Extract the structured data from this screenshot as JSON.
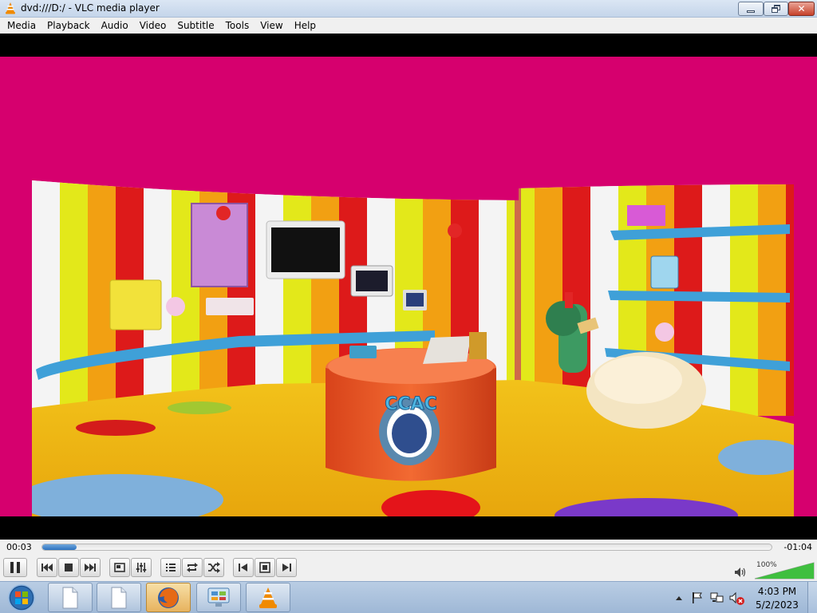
{
  "window": {
    "title": "dvd:///D:/ - VLC media player",
    "app_icon": "vlc-cone-icon"
  },
  "menubar": {
    "items": [
      "Media",
      "Playback",
      "Audio",
      "Video",
      "Subtitle",
      "Tools",
      "View",
      "Help"
    ]
  },
  "video": {
    "description_icon": "cartoon-studio-scene",
    "desk_text": "CCAC",
    "frame_bg": "#d6006e"
  },
  "playback": {
    "elapsed": "00:03",
    "remaining": "-01:04",
    "progress": 0.047
  },
  "controls": {
    "icons": [
      "pause-icon",
      "previous-chapter-icon",
      "stop-icon",
      "next-chapter-icon",
      "fullscreen-icon",
      "extended-settings-icon",
      "playlist-icon",
      "loop-icon",
      "shuffle-icon",
      "frame-back-icon",
      "snapshot-icon",
      "frame-step-icon"
    ]
  },
  "volume": {
    "label": "100%",
    "level": 1.0,
    "icon": "speaker-icon"
  },
  "taskbar": {
    "start_icon": "windows-orb-icon",
    "buttons": [
      "document-icon",
      "document-icon",
      "firefox-icon",
      "control-panel-icon",
      "vlc-cone-icon"
    ],
    "tray_icons": [
      "tray-expand-icon",
      "action-center-flag-icon",
      "network-icon",
      "volume-muted-icon"
    ],
    "time": "4:03 PM",
    "date": "5/2/2023"
  },
  "colors": {
    "accent": "#2d72c0",
    "volume_green": "#3fbf3f"
  }
}
